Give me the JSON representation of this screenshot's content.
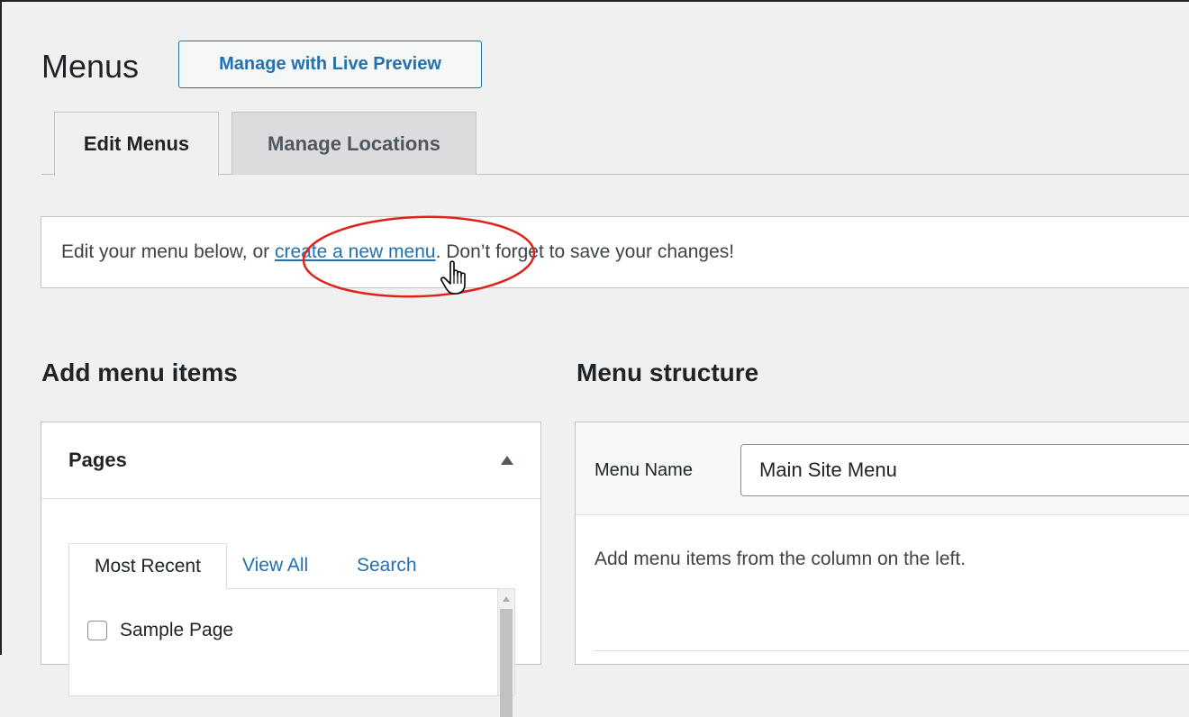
{
  "header": {
    "title": "Menus",
    "live_preview_button": "Manage with Live Preview"
  },
  "tabs": [
    {
      "label": "Edit Menus",
      "active": true
    },
    {
      "label": "Manage Locations",
      "active": false
    }
  ],
  "notice": {
    "text_before": "Edit your menu below, or ",
    "link": "create a new menu",
    "text_after": ". Don’t forget to save your changes!"
  },
  "add_items": {
    "title": "Add menu items",
    "pages_box": {
      "title": "Pages",
      "tabs": [
        "Most Recent",
        "View All",
        "Search"
      ],
      "items": [
        {
          "label": "Sample Page",
          "checked": false
        }
      ]
    }
  },
  "structure": {
    "title": "Menu structure",
    "menu_name_label": "Menu Name",
    "menu_name_value": "Main Site Menu",
    "description": "Add menu items from the column on the left."
  },
  "colors": {
    "accent": "#2271b1",
    "highlight": "#e0221b",
    "background": "#f0f0f1"
  },
  "icons": {
    "collapse": "arrow-up-icon",
    "cursor": "hand-pointer-icon"
  }
}
